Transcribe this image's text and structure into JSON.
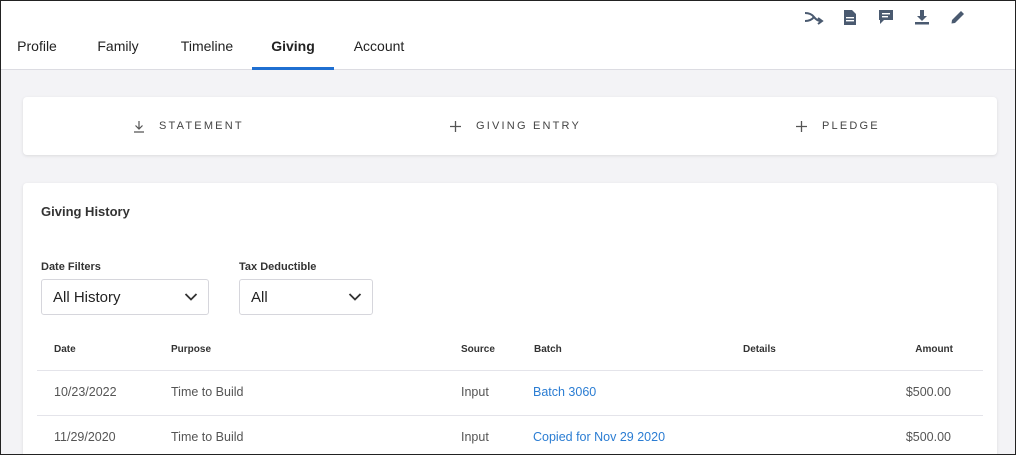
{
  "header": {
    "icons": [
      "merge-icon",
      "document-icon",
      "comment-icon",
      "download-icon",
      "pencil-icon"
    ],
    "tabs": [
      {
        "label": "Profile"
      },
      {
        "label": "Family"
      },
      {
        "label": "Timeline"
      },
      {
        "label": "Giving",
        "active": true
      },
      {
        "label": "Account"
      }
    ]
  },
  "actions": {
    "statement": "STATEMENT",
    "giving_entry": "GIVING ENTRY",
    "pledge": "PLEDGE"
  },
  "history": {
    "title": "Giving History",
    "filters": {
      "date_label": "Date Filters",
      "date_value": "All History",
      "tax_label": "Tax Deductible",
      "tax_value": "All"
    },
    "columns": {
      "date": "Date",
      "purpose": "Purpose",
      "source": "Source",
      "batch": "Batch",
      "details": "Details",
      "amount": "Amount"
    },
    "rows": [
      {
        "date": "10/23/2022",
        "purpose": "Time to Build",
        "source": "Input",
        "batch": "Batch 3060",
        "details": "",
        "amount": "$500.00"
      },
      {
        "date": "11/29/2020",
        "purpose": "Time to Build",
        "source": "Input",
        "batch": "Copied for Nov 29 2020",
        "details": "",
        "amount": "$500.00"
      }
    ]
  },
  "colors": {
    "accent": "#1f6fd1",
    "link": "#2b7dd3",
    "background": "#f3f3f6"
  }
}
